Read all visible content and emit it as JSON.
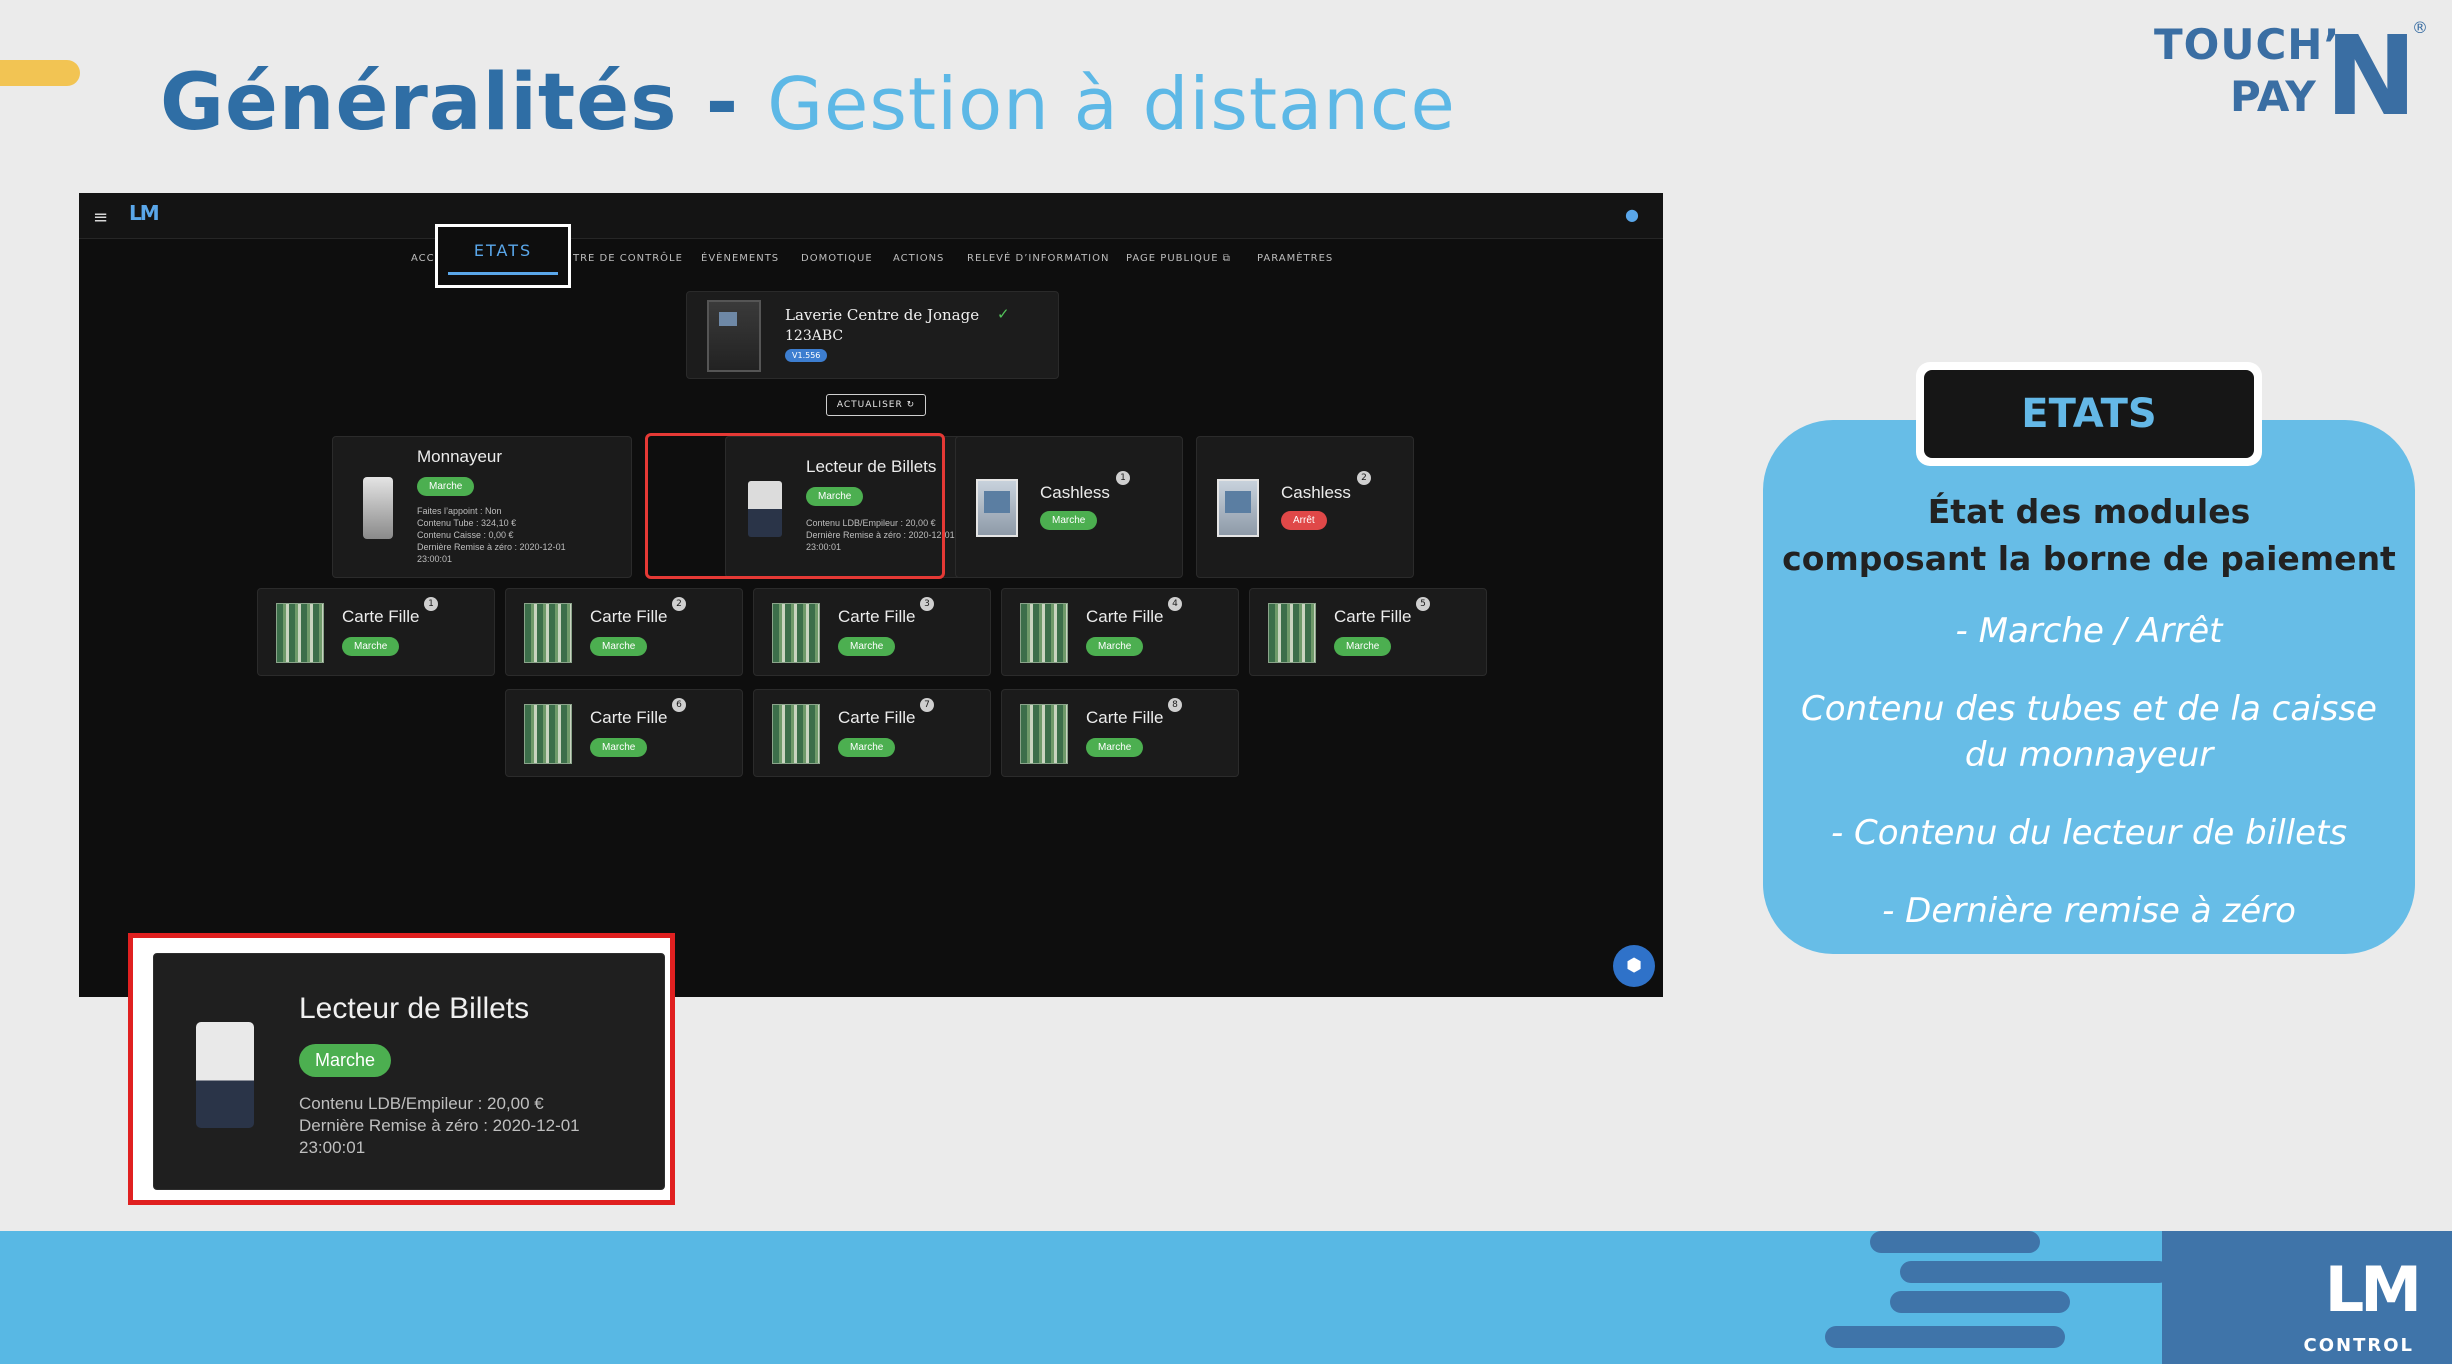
{
  "slide": {
    "title_main": "Généralités -",
    "title_sub": "Gestion à distance"
  },
  "brand": {
    "line1": "TOUCH’",
    "line2": "PAY",
    "letter": "N",
    "reg": "®"
  },
  "app": {
    "menu_icon": "≡",
    "logo": "LM",
    "nav_active": "ETATS",
    "nav_items": [
      "ACC",
      "TRE DE CONTRÔLE",
      "ÉVÈNEMENTS",
      "DOMOTIQUE",
      "ACTIONS",
      "RELEVÉ D’INFORMATION",
      "PAGE PUBLIQUE ⧉",
      "PARAMÈTRES"
    ],
    "device": {
      "name": "Laverie Centre de Jonage",
      "check": "✓",
      "code": "123ABC",
      "version": "V1.556"
    },
    "refresh_label": "ACTUALISER ↻",
    "cards": {
      "monnayeur": {
        "title": "Monnayeur",
        "status": "Marche",
        "lines": [
          "Faites l’appoint : Non",
          "Contenu Tube : 324,10 €",
          "Contenu Caisse : 0,00 €",
          "Dernière Remise à zéro : 2020-12-01",
          "23:00:01"
        ]
      },
      "lecteur": {
        "title": "Lecteur de Billets",
        "status": "Marche",
        "lines": [
          "Contenu LDB/Empileur : 20,00 €",
          "Dernière Remise à zéro : 2020-12-01",
          "23:00:01"
        ]
      },
      "cashless1": {
        "title": "Cashless",
        "num": "1",
        "status": "Marche"
      },
      "cashless2": {
        "title": "Cashless",
        "num": "2",
        "status": "Arrêt"
      },
      "carte_fille": [
        {
          "title": "Carte Fille",
          "num": "1",
          "status": "Marche"
        },
        {
          "title": "Carte Fille",
          "num": "2",
          "status": "Marche"
        },
        {
          "title": "Carte Fille",
          "num": "3",
          "status": "Marche"
        },
        {
          "title": "Carte Fille",
          "num": "4",
          "status": "Marche"
        },
        {
          "title": "Carte Fille",
          "num": "5",
          "status": "Marche"
        },
        {
          "title": "Carte Fille",
          "num": "6",
          "status": "Marche"
        },
        {
          "title": "Carte Fille",
          "num": "7",
          "status": "Marche"
        },
        {
          "title": "Carte Fille",
          "num": "8",
          "status": "Marche"
        }
      ]
    }
  },
  "zoom": {
    "title": "Lecteur de Billets",
    "status": "Marche",
    "line1": "Contenu LDB/Empileur : 20,00 €",
    "line2": "Dernière Remise à zéro : 2020-12-01",
    "line3": "23:00:01"
  },
  "panel": {
    "tab": "ETATS",
    "title1": "État des modules",
    "title2": "composant la borne de paiement",
    "bullet1": "- Marche / Arrêt",
    "bullet2a": "Contenu des tubes et de la caisse",
    "bullet2b": "du monnayeur",
    "bullet3": "- Contenu du lecteur de billets",
    "bullet4": "- Dernière remise à zéro"
  },
  "footer": {
    "logo": "LM",
    "logo_sub": "CONTROL"
  },
  "colors": {
    "title_blue": "#2f6ea5",
    "sub_blue": "#5db8e6",
    "status_on": "#4caf50",
    "status_off": "#e04848",
    "highlight": "#e53935"
  }
}
